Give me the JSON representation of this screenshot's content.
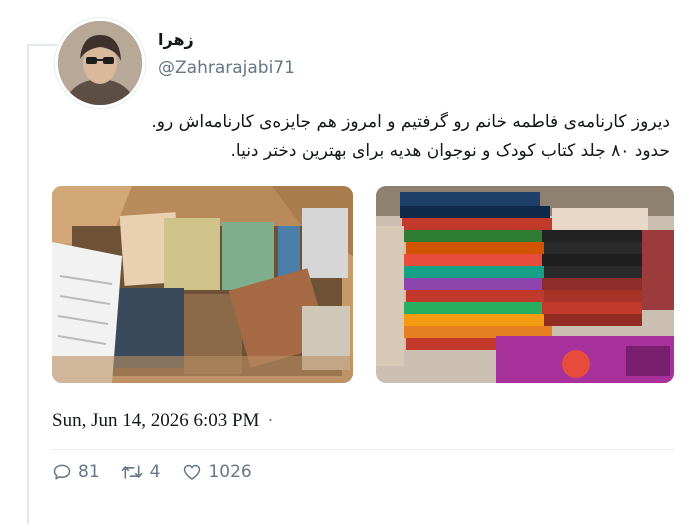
{
  "author": {
    "display_name": "زهرا",
    "handle": "@Zahrarajabi71"
  },
  "tweet": {
    "text_line1": "دیروز کارنامه‌ی فاطمه خانم رو گرفتیم و امروز هم جایزه‌ی کارنامه‌اش رو.",
    "text_line2": "حدود ۸۰ جلد کتاب کودک و نوجوان هدیه برای بهترین دختر دنیا.",
    "timestamp": "Sun, Jun 14, 2026 6:03 PM",
    "timestamp_separator": "·"
  },
  "media": [
    {
      "name": "box-of-books-photo"
    },
    {
      "name": "stacked-books-photo"
    }
  ],
  "actions": {
    "replies": "81",
    "retweets": "4",
    "likes": "1026"
  },
  "icons": {
    "reply": "speech-bubble-icon",
    "retweet": "retweet-arrows-icon",
    "like": "heart-icon"
  },
  "colors": {
    "text": "#14171a",
    "secondary": "#657786",
    "divider": "#e6ecf0"
  }
}
